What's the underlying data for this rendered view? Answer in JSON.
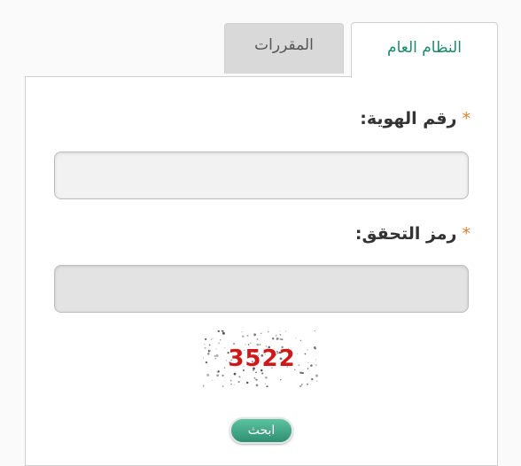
{
  "tabs": [
    {
      "label": "النظام العام",
      "active": true
    },
    {
      "label": "المقررات",
      "active": false
    }
  ],
  "form": {
    "id_label": "رقم الهوية:",
    "id_value": "",
    "code_label": "رمز التحقق:",
    "code_value": "",
    "required_marker": "*",
    "captcha_text": "3522",
    "search_label": "ابحث"
  },
  "colors": {
    "accent": "#1b8a6b",
    "required": "#d9822b",
    "captcha": "#d01818",
    "button": "#3fa583"
  }
}
